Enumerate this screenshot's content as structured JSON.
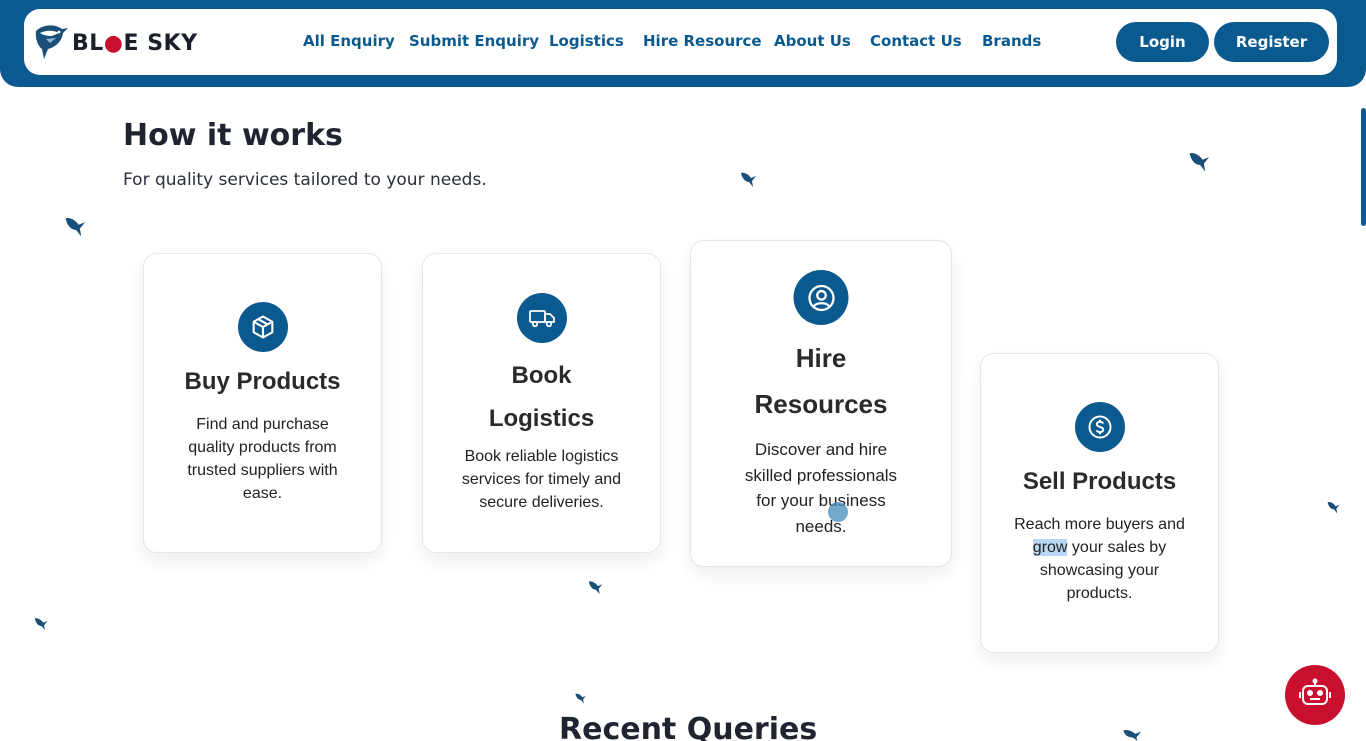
{
  "header": {
    "logo_text_prefix": "BL",
    "logo_text_suffix": "E SKY",
    "nav": [
      "All Enquiry",
      "Submit Enquiry",
      "Logistics",
      "Hire Resource",
      "About Us",
      "Contact Us",
      "Brands"
    ],
    "login_label": "Login",
    "register_label": "Register"
  },
  "how_it_works": {
    "title": "How it works",
    "subtitle": "For quality services tailored to your needs.",
    "cards": [
      {
        "icon": "box-icon",
        "title": "Buy Products",
        "desc": "Find and purchase quality products from trusted suppliers with ease."
      },
      {
        "icon": "truck-icon",
        "title": "Book Logistics",
        "desc": "Book reliable logistics services for timely and secure deliveries."
      },
      {
        "icon": "user-circle-icon",
        "title": "Hire Resources",
        "desc": "Discover and hire skilled professionals for your business needs."
      },
      {
        "icon": "dollar-circle-icon",
        "title": "Sell Products",
        "desc_before": "Reach more buyers and ",
        "desc_highlight": "grow",
        "desc_after": " your sales by showcasing your products."
      }
    ]
  },
  "recent": {
    "title": "Recent Queries"
  },
  "colors": {
    "brand": "#0b5a8f",
    "accent": "#c8102e"
  }
}
